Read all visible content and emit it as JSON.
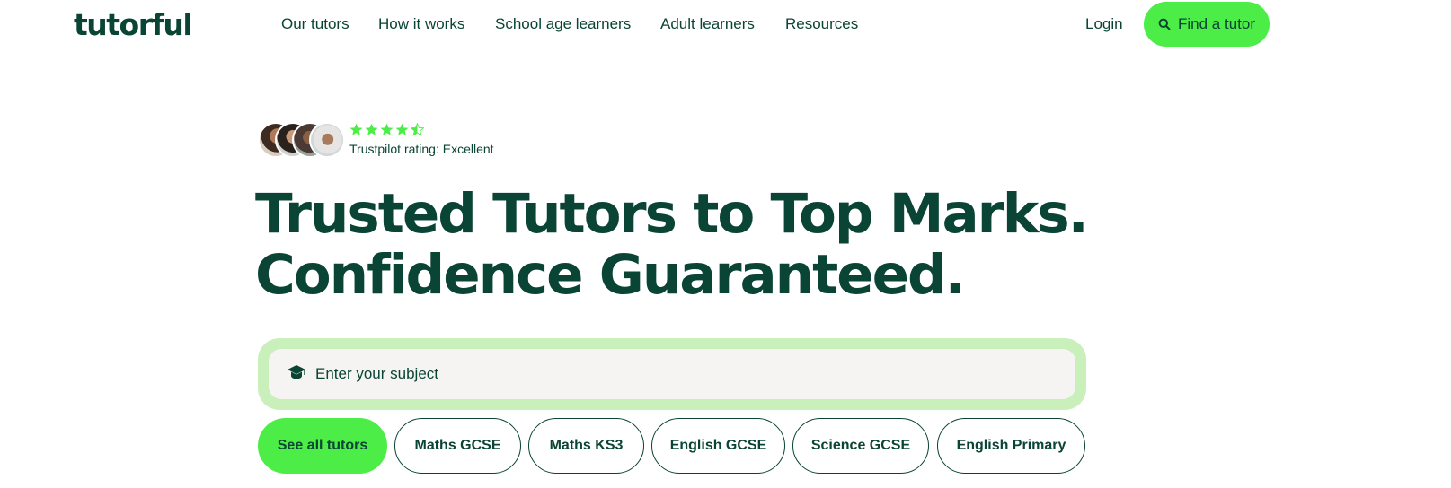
{
  "header": {
    "logo": "tutorful",
    "nav": [
      "Our tutors",
      "How it works",
      "School age learners",
      "Adult learners",
      "Resources"
    ],
    "login_label": "Login",
    "find_label": "Find a tutor",
    "find_icon": "search-icon"
  },
  "trust": {
    "rating_text": "Trustpilot rating: Excellent",
    "stars": 4.5,
    "star_color": "#4ded48"
  },
  "hero": {
    "line1": "Trusted Tutors to Top Marks.",
    "line2": "Confidence Guaranteed."
  },
  "search": {
    "placeholder": "Enter your subject",
    "icon": "graduation-cap-icon"
  },
  "chips": [
    "See all tutors",
    "Maths GCSE",
    "Maths KS3",
    "English GCSE",
    "Science GCSE",
    "English Primary"
  ],
  "colors": {
    "brand_dark": "#0a4434",
    "accent_green": "#4ded48",
    "search_frame": "#c9efbb",
    "search_field": "#f5f4f2"
  }
}
